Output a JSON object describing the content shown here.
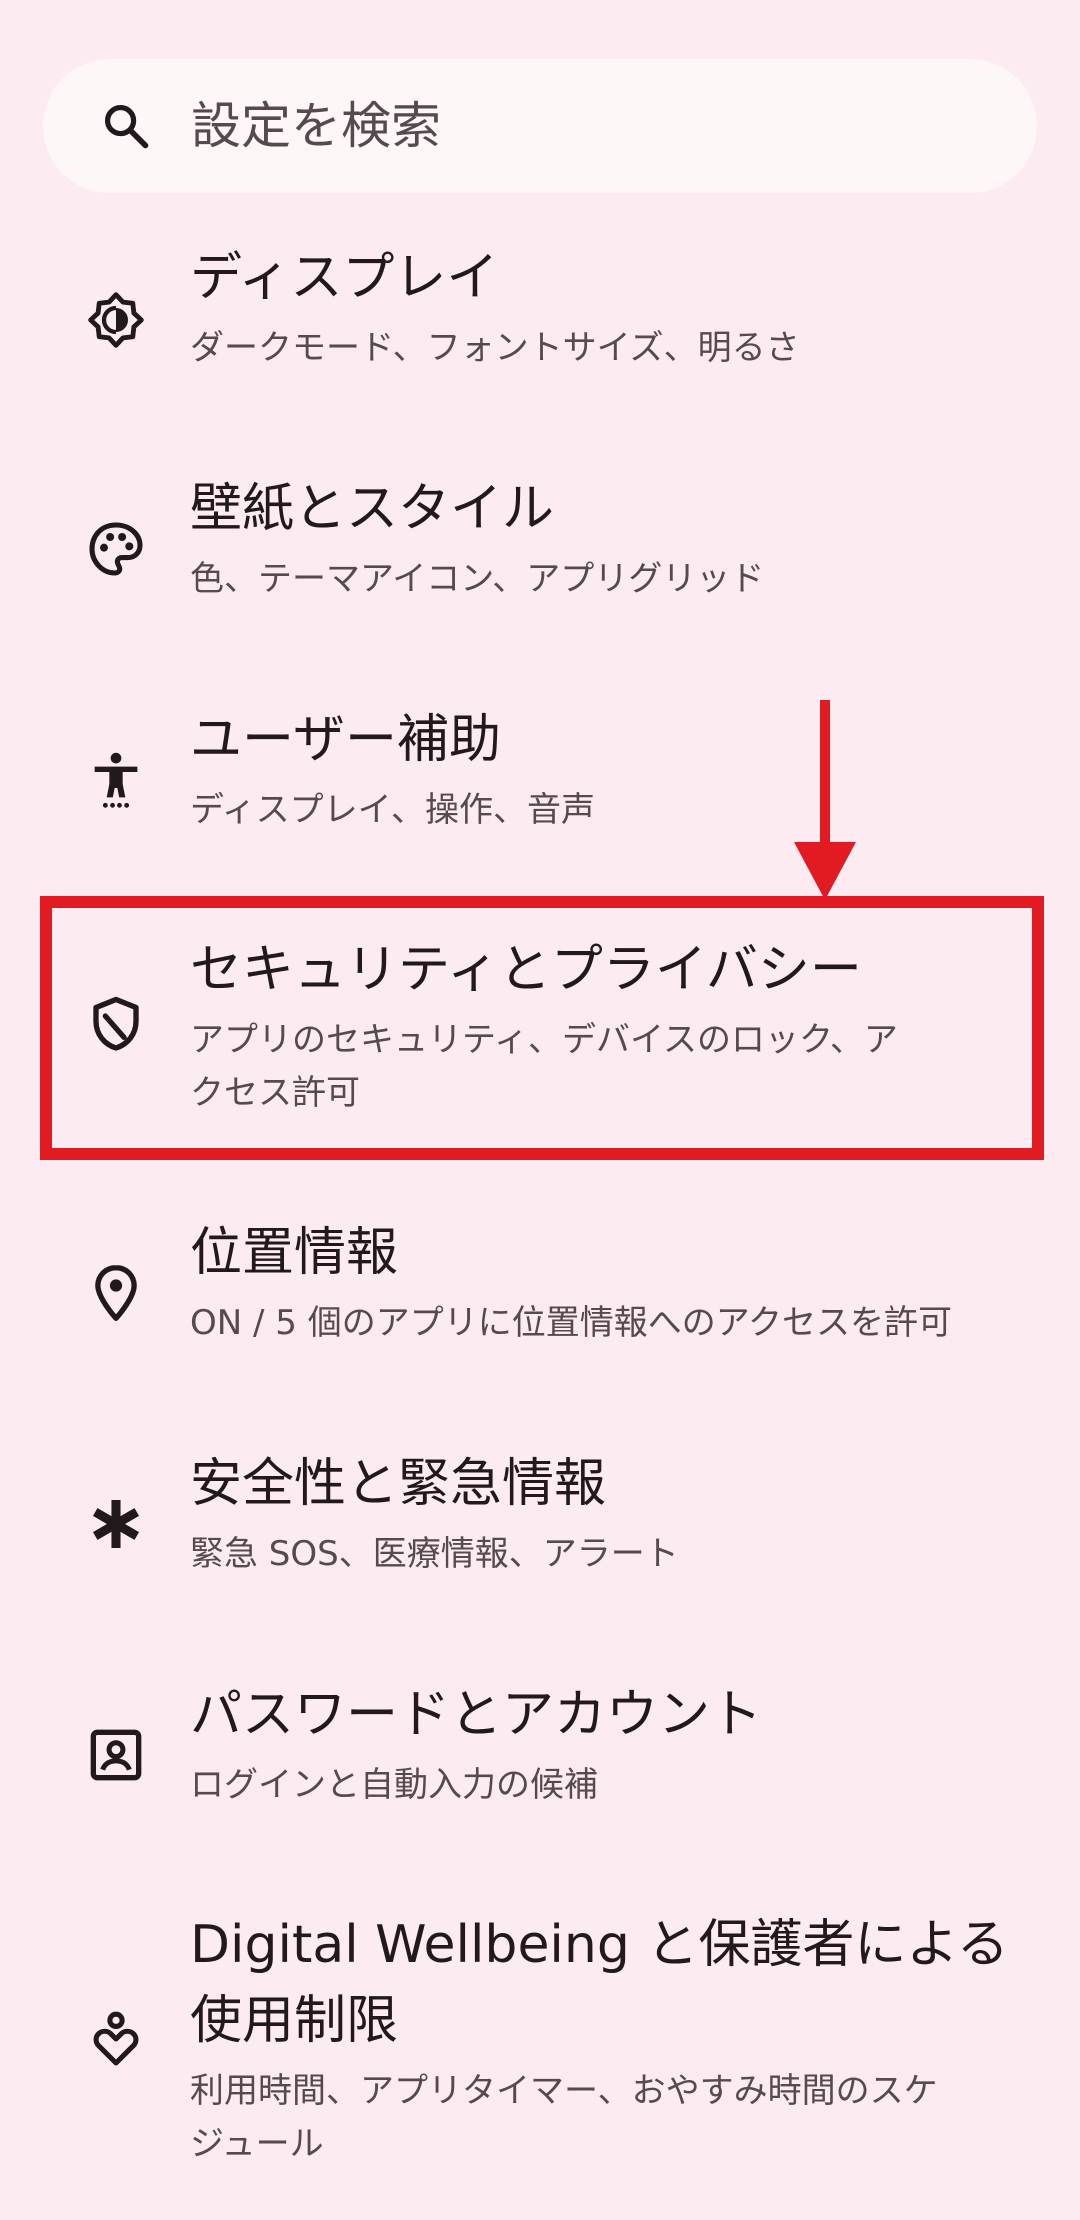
{
  "search": {
    "placeholder": "設定を検索"
  },
  "items": [
    {
      "title": "ディスプレイ",
      "subtitle": "ダークモード、フォントサイズ、明るさ",
      "icon": "display-brightness-icon"
    },
    {
      "title": "壁紙とスタイル",
      "subtitle": "色、テーマアイコン、アプリグリッド",
      "icon": "palette-icon"
    },
    {
      "title": "ユーザー補助",
      "subtitle": "ディスプレイ、操作、音声",
      "icon": "accessibility-icon"
    },
    {
      "title": "セキュリティとプライバシー",
      "subtitle": "アプリのセキュリティ、デバイスのロック、アクセス許可",
      "icon": "shield-icon"
    },
    {
      "title": "位置情報",
      "subtitle": "ON / 5 個のアプリに位置情報へのアクセスを許可",
      "icon": "location-pin-icon"
    },
    {
      "title": "安全性と緊急情報",
      "subtitle": "緊急 SOS、医療情報、アラート",
      "icon": "asterisk-icon"
    },
    {
      "title": "パスワードとアカウント",
      "subtitle": "ログインと自動入力の候補",
      "icon": "account-box-icon"
    },
    {
      "title": "Digital Wellbeing と保護者による使用制限",
      "subtitle": "利用時間、アプリタイマー、おやすみ時間のスケジュール",
      "icon": "wellbeing-icon"
    }
  ],
  "annotation": {
    "highlight_color": "#e21b23"
  },
  "colors": {
    "background": "#fcebf0",
    "search_bg": "#fef7f8",
    "title_text": "#21191c",
    "subtitle_text": "#554a4f"
  }
}
